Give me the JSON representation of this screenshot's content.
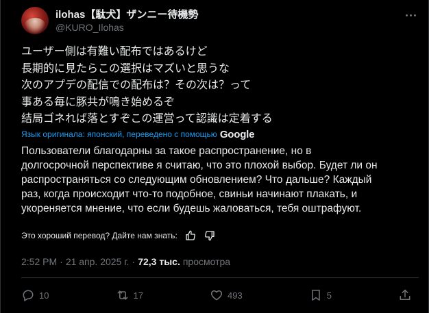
{
  "author": {
    "display_name": "ilohas【駄犬】ザンニー待機勢",
    "handle": "@KURO_Ilohas"
  },
  "original_lines": [
    "ユーザー側は有難い配布ではあるけど",
    "長期的に見たらこの選択はマズいと思うな",
    "次のアプデの配信での配布は？その次は？って",
    "事ある毎に豚共が鳴き始めるぞ",
    "結局ゴネれば落とすぞこの運営って認識は定着する"
  ],
  "translation_notice": "Язык оригинала: японский, переведено с помощью",
  "translation_provider": "Google",
  "translation_lines": [
    "Пользователи благодарны за такое распространение, но в",
    "долгосрочной перспективе я считаю, что это плохой выбор. Будет ли он",
    "распространяться со следующим обновлением? Что дальше? Каждый",
    "раз, когда происходит что-то подобное, свиньи начинают плакать, и",
    "укореняется мнение, что если будешь жаловаться, тебя оштрафуют."
  ],
  "feedback_prompt": "Это хороший перевод? Дайте нам знать:",
  "meta": {
    "time": "2:52 PM",
    "date": "21 апр. 2025 г.",
    "views_count": "72,3 тыс.",
    "views_label": "просмотра"
  },
  "actions": {
    "replies": "10",
    "reposts": "17",
    "likes": "493",
    "bookmarks": "5"
  },
  "colors": {
    "background": "#000000",
    "text": "#e7e9ea",
    "secondary": "#71767b",
    "link": "#1d9bf0",
    "divider": "#2f3336"
  },
  "icons": [
    "more-icon",
    "thumbs-up-icon",
    "thumbs-down-icon",
    "reply-icon",
    "repost-icon",
    "like-icon",
    "bookmark-icon",
    "share-icon"
  ]
}
